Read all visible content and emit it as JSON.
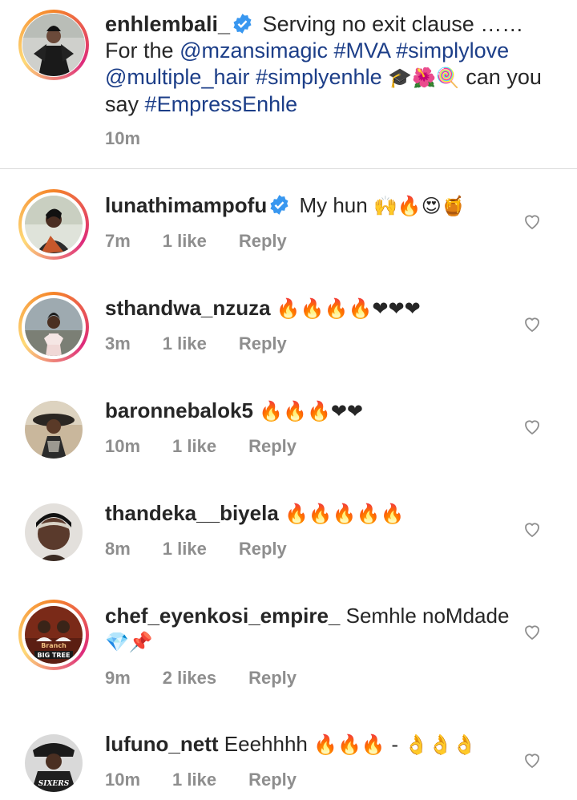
{
  "caption": {
    "username": "enhlembali_",
    "text_part1": "Serving no exit clause ……For the",
    "mention1": "@mzansimagic",
    "hashtag1": "#MVA",
    "hashtag2": "#simplylove",
    "mention2": "@multiple_hair",
    "hashtag3": "#simplyenhle",
    "emojis": "🎓🌺🍭",
    "text_part2": "can you say",
    "hashtag4": "#EmpressEnhle",
    "time": "10m"
  },
  "comments": [
    {
      "username": "lunathimampofu",
      "verified": true,
      "text": "My hun",
      "emojis": "🙌🔥😍🍯",
      "time": "7m",
      "likes": "1 like",
      "reply": "Reply"
    },
    {
      "username": "sthandwa_nzuza",
      "verified": false,
      "text": "",
      "emojis": "🔥🔥🔥🔥❤❤❤",
      "time": "3m",
      "likes": "1 like",
      "reply": "Reply"
    },
    {
      "username": "baronnebalok5",
      "verified": false,
      "text": "",
      "emojis": "🔥🔥🔥❤❤",
      "time": "10m",
      "likes": "1 like",
      "reply": "Reply"
    },
    {
      "username": "thandeka__biyela",
      "verified": false,
      "text": "",
      "emojis": "🔥🔥🔥🔥🔥",
      "time": "8m",
      "likes": "1 like",
      "reply": "Reply"
    },
    {
      "username": "chef_eyenkosi_empire_",
      "verified": false,
      "text": "Semhle noMdade",
      "emojis": "💎📌",
      "time": "9m",
      "likes": "2 likes",
      "reply": "Reply"
    },
    {
      "username": "lufuno_nett",
      "verified": false,
      "text": "Eeehhhh",
      "emojis": "🔥🔥🔥 - 👌👌👌",
      "time": "10m",
      "likes": "1 like",
      "reply": "Reply"
    }
  ],
  "avatar_labels": {
    "chef_line1": "Branch",
    "chef_line2": "BIG TREE",
    "lufuno_jersey": "SIXERS"
  },
  "colors": {
    "text": "#262626",
    "meta": "#8e8e8e",
    "link": "#1c3e88",
    "verified": "#3897f0",
    "fire": "#f7931e",
    "heart_red": "#e0151f"
  }
}
